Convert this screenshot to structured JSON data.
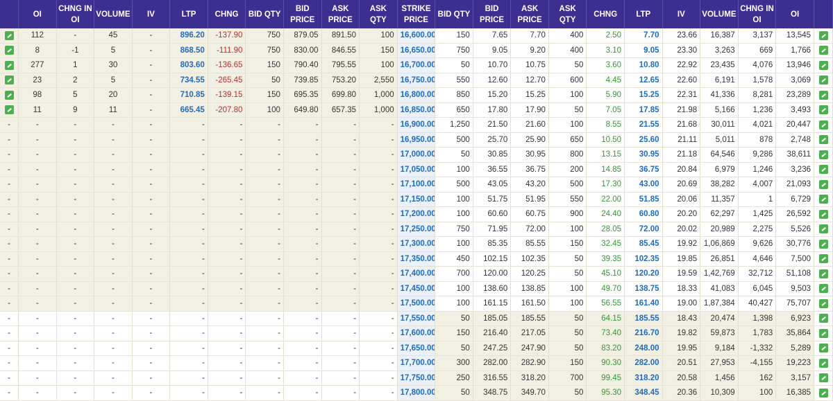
{
  "headers": {
    "calls": [
      "OI",
      "CHNG IN OI",
      "VOLUME",
      "IV",
      "LTP",
      "CHNG",
      "BID QTY",
      "BID PRICE",
      "ASK PRICE",
      "ASK QTY"
    ],
    "strike": "STRIKE PRICE",
    "puts": [
      "BID QTY",
      "BID PRICE",
      "ASK PRICE",
      "ASK QTY",
      "CHNG",
      "LTP",
      "IV",
      "VOLUME",
      "CHNG IN OI",
      "OI"
    ]
  },
  "rows": [
    {
      "strike": "16,600.00",
      "call": [
        "112",
        "-",
        "45",
        "-",
        "896.20",
        "-137.90",
        "750",
        "879.05",
        "891.50",
        "100"
      ],
      "put": [
        "150",
        "7.65",
        "7.70",
        "400",
        "2.50",
        "7.70",
        "23.66",
        "16,387",
        "3,137",
        "13,545"
      ]
    },
    {
      "strike": "16,650.00",
      "call": [
        "8",
        "-1",
        "5",
        "-",
        "868.50",
        "-111.90",
        "750",
        "830.00",
        "846.55",
        "150"
      ],
      "put": [
        "750",
        "9.05",
        "9.20",
        "400",
        "3.10",
        "9.05",
        "23.30",
        "3,263",
        "669",
        "1,766"
      ]
    },
    {
      "strike": "16,700.00",
      "call": [
        "277",
        "1",
        "30",
        "-",
        "803.60",
        "-136.65",
        "150",
        "790.40",
        "795.55",
        "100"
      ],
      "put": [
        "50",
        "10.70",
        "10.75",
        "50",
        "3.60",
        "10.80",
        "22.92",
        "23,435",
        "4,076",
        "13,946"
      ]
    },
    {
      "strike": "16,750.00",
      "call": [
        "23",
        "2",
        "5",
        "-",
        "734.55",
        "-265.45",
        "50",
        "739.85",
        "753.20",
        "2,550"
      ],
      "put": [
        "550",
        "12.60",
        "12.70",
        "600",
        "4.45",
        "12.65",
        "22.60",
        "6,191",
        "1,578",
        "3,069"
      ]
    },
    {
      "strike": "16,800.00",
      "call": [
        "98",
        "5",
        "20",
        "-",
        "710.85",
        "-139.15",
        "150",
        "695.35",
        "699.80",
        "1,000"
      ],
      "put": [
        "850",
        "15.20",
        "15.25",
        "100",
        "5.90",
        "15.25",
        "22.31",
        "41,336",
        "8,281",
        "23,289"
      ]
    },
    {
      "strike": "16,850.00",
      "call": [
        "11",
        "9",
        "11",
        "-",
        "665.45",
        "-207.80",
        "100",
        "649.80",
        "657.35",
        "1,000"
      ],
      "put": [
        "650",
        "17.80",
        "17.90",
        "50",
        "7.05",
        "17.85",
        "21.98",
        "5,166",
        "1,236",
        "3,493"
      ]
    },
    {
      "strike": "16,900.00",
      "call": [
        "-",
        "-",
        "-",
        "-",
        "-",
        "-",
        "-",
        "-",
        "-",
        "-"
      ],
      "put": [
        "1,250",
        "21.50",
        "21.60",
        "100",
        "8.55",
        "21.55",
        "21.68",
        "30,011",
        "4,021",
        "20,447"
      ]
    },
    {
      "strike": "16,950.00",
      "call": [
        "-",
        "-",
        "-",
        "-",
        "-",
        "-",
        "-",
        "-",
        "-",
        "-"
      ],
      "put": [
        "500",
        "25.70",
        "25.90",
        "650",
        "10.50",
        "25.60",
        "21.11",
        "5,011",
        "878",
        "2,748"
      ]
    },
    {
      "strike": "17,000.00",
      "call": [
        "-",
        "-",
        "-",
        "-",
        "-",
        "-",
        "-",
        "-",
        "-",
        "-"
      ],
      "put": [
        "50",
        "30.85",
        "30.95",
        "800",
        "13.15",
        "30.95",
        "21.18",
        "64,546",
        "9,286",
        "38,611"
      ]
    },
    {
      "strike": "17,050.00",
      "call": [
        "-",
        "-",
        "-",
        "-",
        "-",
        "-",
        "-",
        "-",
        "-",
        "-"
      ],
      "put": [
        "100",
        "36.55",
        "36.75",
        "200",
        "14.85",
        "36.75",
        "20.84",
        "6,979",
        "1,246",
        "3,236"
      ]
    },
    {
      "strike": "17,100.00",
      "call": [
        "-",
        "-",
        "-",
        "-",
        "-",
        "-",
        "-",
        "-",
        "-",
        "-"
      ],
      "put": [
        "500",
        "43.05",
        "43.20",
        "500",
        "17.30",
        "43.00",
        "20.69",
        "38,282",
        "4,007",
        "21,093"
      ]
    },
    {
      "strike": "17,150.00",
      "call": [
        "-",
        "-",
        "-",
        "-",
        "-",
        "-",
        "-",
        "-",
        "-",
        "-"
      ],
      "put": [
        "100",
        "51.75",
        "51.95",
        "550",
        "22.00",
        "51.85",
        "20.06",
        "11,357",
        "1",
        "6,729"
      ]
    },
    {
      "strike": "17,200.00",
      "call": [
        "-",
        "-",
        "-",
        "-",
        "-",
        "-",
        "-",
        "-",
        "-",
        "-"
      ],
      "put": [
        "100",
        "60.60",
        "60.75",
        "900",
        "24.40",
        "60.80",
        "20.20",
        "62,297",
        "1,425",
        "26,592"
      ]
    },
    {
      "strike": "17,250.00",
      "call": [
        "-",
        "-",
        "-",
        "-",
        "-",
        "-",
        "-",
        "-",
        "-",
        "-"
      ],
      "put": [
        "750",
        "71.95",
        "72.00",
        "100",
        "28.05",
        "72.00",
        "20.02",
        "20,989",
        "2,275",
        "5,526"
      ]
    },
    {
      "strike": "17,300.00",
      "call": [
        "-",
        "-",
        "-",
        "-",
        "-",
        "-",
        "-",
        "-",
        "-",
        "-"
      ],
      "put": [
        "100",
        "85.35",
        "85.55",
        "150",
        "32.45",
        "85.45",
        "19.92",
        "1,06,869",
        "9,626",
        "30,776"
      ]
    },
    {
      "strike": "17,350.00",
      "call": [
        "-",
        "-",
        "-",
        "-",
        "-",
        "-",
        "-",
        "-",
        "-",
        "-"
      ],
      "put": [
        "450",
        "102.15",
        "102.35",
        "50",
        "39.35",
        "102.35",
        "19.85",
        "26,851",
        "4,646",
        "7,500"
      ]
    },
    {
      "strike": "17,400.00",
      "call": [
        "-",
        "-",
        "-",
        "-",
        "-",
        "-",
        "-",
        "-",
        "-",
        "-"
      ],
      "put": [
        "700",
        "120.00",
        "120.25",
        "50",
        "45.10",
        "120.20",
        "19.59",
        "1,42,769",
        "32,712",
        "51,108"
      ]
    },
    {
      "strike": "17,450.00",
      "call": [
        "-",
        "-",
        "-",
        "-",
        "-",
        "-",
        "-",
        "-",
        "-",
        "-"
      ],
      "put": [
        "100",
        "138.60",
        "138.85",
        "100",
        "49.70",
        "138.75",
        "18.33",
        "41,083",
        "6,045",
        "9,503"
      ]
    },
    {
      "strike": "17,500.00",
      "call": [
        "-",
        "-",
        "-",
        "-",
        "-",
        "-",
        "-",
        "-",
        "-",
        "-"
      ],
      "put": [
        "100",
        "161.15",
        "161.50",
        "100",
        "56.55",
        "161.40",
        "19.00",
        "1,87,384",
        "40,427",
        "75,707"
      ]
    },
    {
      "strike": "17,550.00",
      "call": [
        "-",
        "-",
        "-",
        "-",
        "-",
        "-",
        "-",
        "-",
        "-",
        "-"
      ],
      "put": [
        "50",
        "185.05",
        "185.55",
        "50",
        "64.15",
        "185.55",
        "18.43",
        "20,474",
        "1,398",
        "6,923"
      ]
    },
    {
      "strike": "17,600.00",
      "call": [
        "-",
        "-",
        "-",
        "-",
        "-",
        "-",
        "-",
        "-",
        "-",
        "-"
      ],
      "put": [
        "150",
        "216.40",
        "217.05",
        "50",
        "73.40",
        "216.70",
        "19.82",
        "59,873",
        "1,783",
        "35,864"
      ]
    },
    {
      "strike": "17,650.00",
      "call": [
        "-",
        "-",
        "-",
        "-",
        "-",
        "-",
        "-",
        "-",
        "-",
        "-"
      ],
      "put": [
        "50",
        "247.25",
        "247.90",
        "50",
        "83.20",
        "248.00",
        "19.95",
        "9,184",
        "-1,332",
        "5,289"
      ]
    },
    {
      "strike": "17,700.00",
      "call": [
        "-",
        "-",
        "-",
        "-",
        "-",
        "-",
        "-",
        "-",
        "-",
        "-"
      ],
      "put": [
        "300",
        "282.00",
        "282.90",
        "150",
        "90.30",
        "282.00",
        "20.51",
        "27,953",
        "-4,155",
        "19,223"
      ]
    },
    {
      "strike": "17,750.00",
      "call": [
        "-",
        "-",
        "-",
        "-",
        "-",
        "-",
        "-",
        "-",
        "-",
        "-"
      ],
      "put": [
        "250",
        "316.55",
        "318.20",
        "700",
        "99.45",
        "318.20",
        "20.58",
        "1,456",
        "162",
        "3,157"
      ]
    },
    {
      "strike": "17,800.00",
      "call": [
        "-",
        "-",
        "-",
        "-",
        "-",
        "-",
        "-",
        "-",
        "-",
        "-"
      ],
      "put": [
        "50",
        "348.75",
        "349.70",
        "50",
        "95.30",
        "348.45",
        "20.36",
        "10,309",
        "100",
        "16,385"
      ]
    }
  ]
}
